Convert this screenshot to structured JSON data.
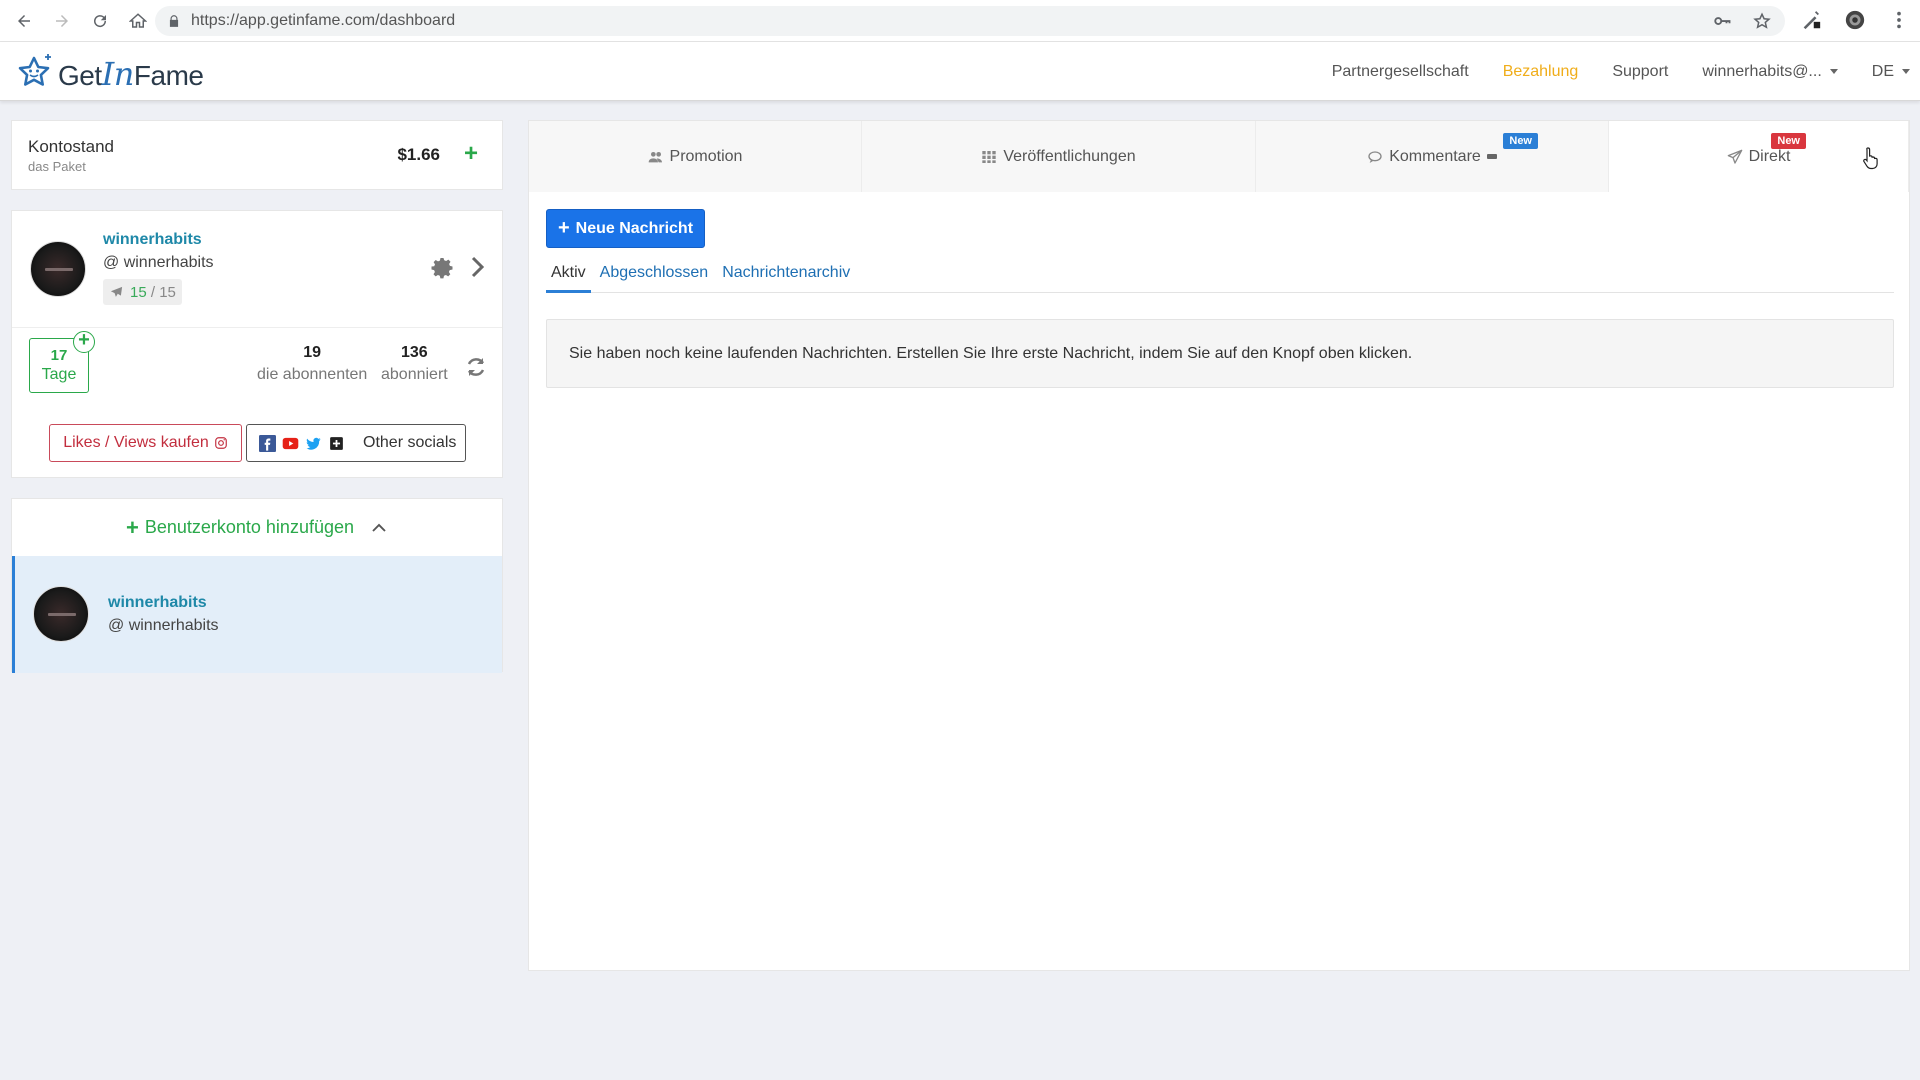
{
  "browser": {
    "url": "https://app.getinfame.com/dashboard"
  },
  "header": {
    "logo": {
      "part1": "Get",
      "part2": "In",
      "part3": "Fame"
    },
    "nav": [
      {
        "label": "Partnergesellschaft"
      },
      {
        "label": "Bezahlung"
      },
      {
        "label": "Support"
      },
      {
        "label": "winnerhabits@..."
      },
      {
        "label": "DE"
      }
    ]
  },
  "balance": {
    "title": "Kontostand",
    "subtitle": "das Paket",
    "amount": "$1.66",
    "add": "+"
  },
  "account": {
    "name": "winnerhabits",
    "handle": "@ winnerhabits",
    "promo_used": "15",
    "promo_sep": "/",
    "promo_total": "15",
    "days_value": "17",
    "days_label": "Tage",
    "followers_value": "19",
    "followers_label": "die abonnenten",
    "following_value": "136",
    "following_label": "abonniert",
    "likes_button": "Likes / Views kaufen",
    "other_socials": "Other socials"
  },
  "add_account": {
    "label": "Benutzerkonto hinzufügen",
    "item": {
      "name": "winnerhabits",
      "handle": "@ winnerhabits"
    }
  },
  "main": {
    "tabs": [
      {
        "label": "Promotion",
        "icon": "users-icon"
      },
      {
        "label": "Veröffentlichungen",
        "icon": "grid-icon"
      },
      {
        "label": "Kommentare",
        "icon": "comment-icon",
        "badge": "New"
      },
      {
        "label": "Direkt",
        "icon": "paper-plane-icon",
        "badge": "New"
      }
    ],
    "new_message_button": "Neue Nachricht",
    "subtabs": [
      {
        "label": "Aktiv"
      },
      {
        "label": "Abgeschlossen"
      },
      {
        "label": "Nachrichtenarchiv"
      }
    ],
    "notice": "Sie haben noch keine laufenden Nachrichten. Erstellen Sie Ihre erste Nachricht, indem Sie auf den Knopf oben klicken."
  },
  "colors": {
    "accent_blue": "#1a73e8",
    "brand_green": "#2aa84a",
    "nav_active": "#f0ad1a",
    "badge_red": "#d9363e"
  }
}
